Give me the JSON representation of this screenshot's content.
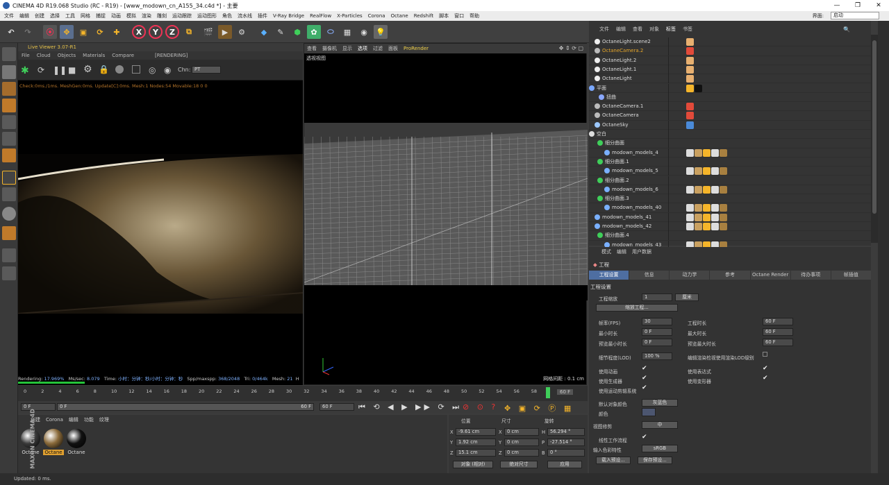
{
  "window": {
    "title": "CINEMA 4D R19.068 Studio (RC - R19) - [www_modown_cn_A155_34.c4d *] - 主要",
    "min": "—",
    "max": "❐",
    "close": "✕"
  },
  "menubar": {
    "items": [
      "文件",
      "编辑",
      "创建",
      "选择",
      "工具",
      "网格",
      "捕捉",
      "动画",
      "模拟",
      "渲染",
      "雕刻",
      "运动跟踪",
      "运动图形",
      "角色",
      "流水线",
      "插件",
      "V-Ray Bridge",
      "RealFlow",
      "X-Particles",
      "Corona",
      "Octane",
      "Redshift",
      "脚本",
      "窗口",
      "帮助"
    ],
    "ui_label": "界面:",
    "ui_value": "启动"
  },
  "liveviewer": {
    "title": "Live Viewer 3.07-R1",
    "menu": [
      "File",
      "Cloud",
      "Objects",
      "Materials",
      "Compare",
      "[RENDERING]"
    ],
    "chn_label": "Chn:",
    "chn_value": "PT",
    "status": "Check:0ms./1ms. MeshGen:0ms. Update[C]:0ms. Mesh:1 Nodes:54 Movable:18  0 0",
    "rendering_label": "Rendering:",
    "rendering_value": "17.969%",
    "mssec_label": "Ms/sec:",
    "mssec_value": "8.079",
    "time_label": "Time:",
    "time_value": "小时：分钟：秒/小时：分钟：秒",
    "spp_label": "Spp/maxspp:",
    "spp_value": "368/2048",
    "tri_label": "Tri:",
    "tri_value": "0/464k",
    "mesh_label": "Mesh:",
    "mesh_value": "21",
    "hair_label": "H",
    "progress": 0.18
  },
  "viewport": {
    "menu": [
      "查看",
      "摄像机",
      "显示",
      "选项",
      "过滤",
      "面板",
      "ProRender"
    ],
    "label": "透视视图",
    "grid_spacing": "网格间距 : 0.1 cm"
  },
  "objects": {
    "menu": [
      "文件",
      "编辑",
      "查看",
      "对象",
      "标签",
      "书签"
    ],
    "active_menu": "标签",
    "rows": [
      {
        "name": "OctaneLight.scene2",
        "hl": false,
        "icon": "light-icon"
      },
      {
        "name": "OctaneCamera.2",
        "hl": true,
        "icon": "camera-icon"
      },
      {
        "name": "OctaneLight.2",
        "hl": false,
        "icon": "light-icon"
      },
      {
        "name": "OctaneLight.1",
        "hl": false,
        "icon": "light-icon"
      },
      {
        "name": "OctaneLight",
        "hl": false,
        "icon": "light-icon"
      },
      {
        "name": "平面",
        "hl": false,
        "icon": "plane-icon"
      },
      {
        "name": "扭曲",
        "hl": false,
        "icon": "deformer-icon"
      },
      {
        "name": "OctaneCamera.1",
        "hl": false,
        "icon": "camera-icon"
      },
      {
        "name": "OctaneCamera",
        "hl": false,
        "icon": "camera-icon"
      },
      {
        "name": "OctaneSky",
        "hl": false,
        "icon": "sky-icon"
      },
      {
        "name": "空白",
        "hl": false,
        "icon": "null-icon"
      },
      {
        "name": "细分曲面",
        "hl": false,
        "icon": "subdivision-icon"
      },
      {
        "name": "modown_models_4",
        "hl": false,
        "icon": "mesh-icon"
      },
      {
        "name": "细分曲面.1",
        "hl": false,
        "icon": "subdivision-icon"
      },
      {
        "name": "modown_models_5",
        "hl": false,
        "icon": "mesh-icon"
      },
      {
        "name": "细分曲面.2",
        "hl": false,
        "icon": "subdivision-icon"
      },
      {
        "name": "modown_models_6",
        "hl": false,
        "icon": "mesh-icon"
      },
      {
        "name": "细分曲面.3",
        "hl": false,
        "icon": "subdivision-icon"
      },
      {
        "name": "modown_models_40",
        "hl": false,
        "icon": "mesh-icon"
      },
      {
        "name": "modown_models_41",
        "hl": false,
        "icon": "mesh-icon"
      },
      {
        "name": "modown_models_42",
        "hl": false,
        "icon": "mesh-icon"
      },
      {
        "name": "细分曲面.4",
        "hl": false,
        "icon": "subdivision-icon"
      },
      {
        "name": "modown_models_43",
        "hl": false,
        "icon": "mesh-icon"
      }
    ]
  },
  "attributes": {
    "menu": [
      "模式",
      "编辑",
      "用户数据"
    ],
    "title": "工程",
    "tabs": [
      "工程设置",
      "信息",
      "动力学",
      "参考",
      "Octane Render",
      "待办事项",
      "帧插值"
    ],
    "section": "工程设置",
    "scale_label": "工程缩放",
    "scale_value": "1",
    "scale_unit": "厘米",
    "scale_btn": "缩放工程...",
    "fps_label": "帧率(FPS)",
    "fps_value": "30",
    "duration_label": "工程时长",
    "duration_value": "60 F",
    "min_label": "最小时长",
    "min_value": "0 F",
    "max_label": "最大时长",
    "max_value": "60 F",
    "pmin_label": "预览最小时长",
    "pmin_value": "0 F",
    "pmax_label": "预览最大时长",
    "pmax_value": "60 F",
    "lod_label": "细节程度(LOD)",
    "lod_value": "100 %",
    "lod_render_label": "编辑渲染检视使用渲染LOD级别",
    "anim_label": "使用动画",
    "expr_label": "使用表达式",
    "gen_label": "使用生成器",
    "deform_label": "使用变形器",
    "mograph_label": "使用运动剪辑系统",
    "defcolor_label": "默认对象颜色",
    "defcolor_value": "灰蓝色",
    "color_label": "颜色",
    "clip_label": "视图修剪",
    "clip_value": "中",
    "linear_label": "线性工作流程",
    "profile_label": "输入色彩特性",
    "profile_value": "sRGB",
    "load_btn": "载入预设...",
    "save_btn": "保存预设..."
  },
  "timeline": {
    "ticks": [
      "0",
      "2",
      "4",
      "6",
      "8",
      "10",
      "12",
      "14",
      "16",
      "18",
      "20",
      "22",
      "24",
      "26",
      "28",
      "30",
      "32",
      "34",
      "36",
      "38",
      "40",
      "42",
      "44",
      "46",
      "48",
      "50",
      "52",
      "54",
      "56",
      "58"
    ],
    "end": "60 F",
    "start_field": "0 F",
    "range_start": "0 F",
    "range_end": "60 F",
    "end_field": "60 F"
  },
  "materials": {
    "menu": [
      "创建",
      "Corona",
      "编辑",
      "功能",
      "纹理"
    ],
    "items": [
      {
        "name": "Octane",
        "color": "#3a3a3a"
      },
      {
        "name": "Octane",
        "color": "#8a6a3a"
      },
      {
        "name": "Octane",
        "color": "#111111"
      }
    ]
  },
  "coords": {
    "pos_label": "位置",
    "size_label": "尺寸",
    "rot_label": "旋转",
    "x": "-9.61 cm",
    "y": "1.92 cm",
    "z": "15.1 cm",
    "sx": "0 cm",
    "sy": "0 cm",
    "sz": "0 cm",
    "h": "56.294 °",
    "p": "-27.514 °",
    "b": "0 °",
    "mode": "对象 (相对)",
    "size_mode": "绝对尺寸",
    "apply": "应用"
  },
  "status": "Updated: 0 ms.",
  "brand": {
    "line1": "MAXON",
    "line2": "CINEMA 4D"
  }
}
